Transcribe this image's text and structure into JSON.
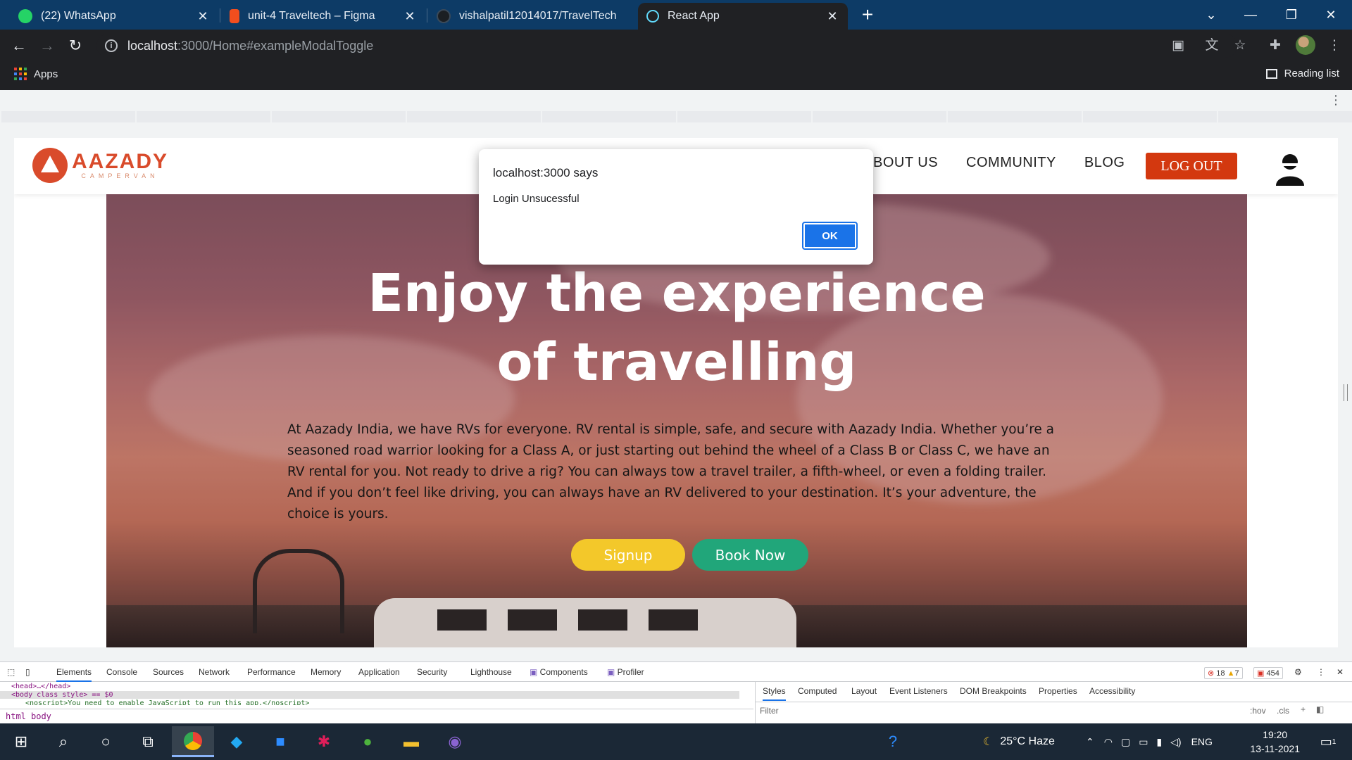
{
  "browser": {
    "tabs": [
      {
        "label": "(22) WhatsApp",
        "icon": "whatsapp-icon",
        "color": "#25d366"
      },
      {
        "label": "unit-4 Traveltech – Figma",
        "icon": "figma-icon",
        "color": "#f24e1e"
      },
      {
        "label": "vishalpatil12014017/TravelTech",
        "icon": "github-icon",
        "color": "#1b1f23"
      },
      {
        "label": "React App",
        "icon": "react-icon",
        "color": "#61dafb"
      }
    ],
    "active_tab": "React App",
    "url_host": "localhost",
    "url_rest": ":3000/Home#exampleModalToggle",
    "bookmarks": {
      "apps_label": "Apps",
      "reading_list_label": "Reading list"
    }
  },
  "dialog": {
    "title": "localhost:3000 says",
    "message": "Login Unsucessful",
    "ok_label": "OK"
  },
  "site": {
    "brand": "AAZADY",
    "brand_sub": "CAMPERVAN",
    "brand_color": "#d94b2b",
    "nav": [
      "BOUT US",
      "COMMUNITY",
      "BLOG"
    ],
    "logout_label": "LOG OUT",
    "hero": {
      "title_line1": "Enjoy the experience",
      "title_line2": "of travelling",
      "body": "At Aazady India, we have RVs for everyone. RV rental is simple, safe, and secure with Aazady India. Whether you’re a seasoned road warrior looking for a Class A, or just starting out behind the wheel of a Class B or Class C, we have an RV rental for you. Not ready to drive a rig? You can always tow a travel trailer, a fifth-wheel, or even a folding trailer. And if you don’t feel like driving, you can always have an RV delivered to your destination. It’s your adventure, the choice is yours.",
      "signup_label": "Signup",
      "book_label": "Book Now",
      "signup_color": "#f3c82a",
      "book_color": "#21a67a"
    }
  },
  "devtools": {
    "tabs": [
      "Elements",
      "Console",
      "Sources",
      "Network",
      "Performance",
      "Memory",
      "Application",
      "Security",
      "Lighthouse",
      "Components",
      "Profiler"
    ],
    "errors": "18",
    "warnings": "7",
    "issues": "454",
    "dom_lines": [
      "<head>…</head>",
      "<body class style> == $0",
      "<noscript>You need to enable JavaScript to run this app.</noscript>"
    ],
    "crumbs": [
      "html",
      "body"
    ],
    "styles_tabs": [
      "Styles",
      "Computed",
      "Layout",
      "Event Listeners",
      "DOM Breakpoints",
      "Properties",
      "Accessibility"
    ],
    "filter_placeholder": "Filter",
    "hov_label": ":hov",
    "cls_label": ".cls"
  },
  "taskbar": {
    "weather": "25°C  Haze",
    "lang": "ENG",
    "time": "19:20",
    "date": "13-11-2021",
    "notifications": "1"
  }
}
